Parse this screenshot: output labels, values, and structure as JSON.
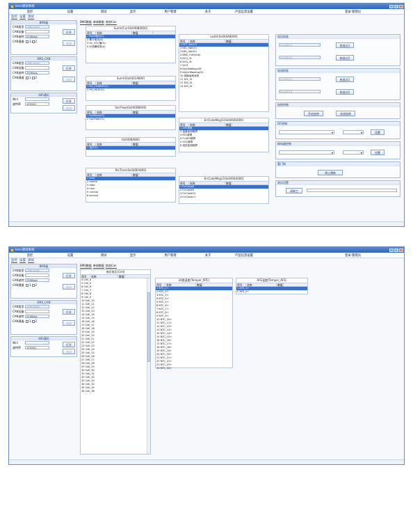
{
  "title": "bms测试系统",
  "titlebar_btns": [
    "_",
    "□",
    "×"
  ],
  "menu": [
    "监控",
    "设置",
    "测试",
    "显示",
    "用户管理",
    "关于",
    "产品信息设置"
  ],
  "status_user": "登录:管理员",
  "subtabs": [
    "监控",
    "设置",
    "测试"
  ],
  "left": {
    "g1_title": "BMS板",
    "can_type_lbl": "CAN类型",
    "can_type_val": "USBCAN2II",
    "can_dev_lbl": "CAN设备",
    "can_rate_lbl": "CAN波特",
    "can_rate_val": "250Kbps",
    "can_ch_lbl": "CAN通道",
    "ch1": "1",
    "ch2": "2",
    "open_btn": "打开",
    "close_btn": "关闭",
    "g2_title": "EMS_CAN",
    "g3_title": "485通讯",
    "port_lbl": "串口",
    "baud_lbl": "波特率",
    "baud_val": "115200"
  },
  "tabs1": [
    "BMS数据",
    "单体数据",
    "其他Can"
  ],
  "tabs2": [
    "BMS数据",
    "单体数据",
    "其他Can"
  ],
  "th": {
    "idx": "序号",
    "name": "名称",
    "val": "数值"
  },
  "p_sum": {
    "title": "SumV/Cur(0x04080000)",
    "rows": [
      "1 Pack电压(V)",
      "2 累计电流(A)",
      "3 Hv_SOC值(%)",
      "4 分流器电流(A)"
    ]
  },
  "p_sumv": {
    "title": "SumV(0x0401A800)",
    "rows": [
      "1 HV_CHARGE(V)",
      "2 HV_HEAT(V)"
    ]
  },
  "p_soc": {
    "title": "SocFlow(0x040D8000)",
    "rows": [
      "1 SocRatio(%)",
      "2 SocFloat(%)"
    ]
  },
  "p_0e": {
    "title": "0x040BA800",
    "rows": [
      "1 温升(V)"
    ]
  },
  "p_rtc": {
    "title": "RtcTime(0x040EA800)",
    "rows": [
      "1 year",
      "2 month",
      "3 date",
      "4 hour",
      "5 minute",
      "6 second"
    ]
  },
  "p_low": {
    "title": "LowV(0x040A8000)",
    "rows": [
      "1 KEY_Volt(V)",
      "2 KEL_Volt(V)",
      "3 KEL_Volt(V)",
      "4 BMS_CUR(mA)",
      "5 DO1_St",
      "6 DO2_St",
      "7 DO3",
      "8 Key(Wakeup)St",
      "9 Key2(Wakeup)St",
      "10 风扇运转状态",
      "11 DI1_St",
      "12 DI2_St",
      "13 DI3_St"
    ]
  },
  "p_err1": {
    "title": "ErrCodeMsg(1(0x04040000)",
    "rows": [
      "1 APE故障",
      "2 温度检测故障",
      "3 RTC故障",
      "4 FLASH故障",
      "5 SOC故障",
      "6 电压检测故障"
    ]
  },
  "p_err2": {
    "title": "ErrCodeMsg(2(0x04044000)",
    "rows": [
      "1 ErrCode8",
      "2 ErrCode9",
      "3 ErrCode10",
      "4 ErrCode11"
    ]
  },
  "right": {
    "g_volt": "电压校准",
    "v_ph1": "0.0-655.3",
    "v_ph2": "0.0-655.3",
    "btn_v1": "校准点1",
    "btn_v2": "校准点2",
    "g_cur": "电流校准",
    "c_ph1": "0.0-655.3",
    "c_ph2": "0.0-655.3",
    "btn_c1": "校准点1",
    "btn_c2": "校准点2",
    "g_heat": "加热控制",
    "btn_on": "开启加热",
    "btn_off": "关闭加热",
    "g_do": "DO控制",
    "set1": "设置",
    "g_relay": "继电器控制",
    "set2": "设置",
    "g_door": "看门狗",
    "btn_door": "停止喂狗",
    "g_test": "测试设置",
    "btn_write": "读取工"
  },
  "cells": {
    "title": "电芯电压(Cell)",
    "rows": [
      "4 Cell_4",
      "5 Cell_5",
      "6 Cell_6",
      "7 Cell_7",
      "8 Cell_8",
      "9 Cell_9",
      "10 Cell_10",
      "11 Cell_11",
      "12 Cell_12",
      "13 Cell_13",
      "14 Cell_14",
      "15 Cell_15",
      "16 Cell_16",
      "17 Cell_17",
      "18 Cell_18",
      "19 Cell_19",
      "20 Cell_20",
      "21 Cell_21",
      "22 Cell_22",
      "23 Cell_23",
      "24 Cell_24",
      "25 Cell_25",
      "26 Cell_26",
      "27 Cell_27",
      "28 Cell_28",
      "29 Cell_29",
      "30 Cell_30",
      "31 Cell_31",
      "32 Cell_32",
      "33 Cell_33",
      "34 Cell_34",
      "35 Cell_35",
      "36 Cell_36"
    ]
  },
  "ntc": {
    "title": "24路温度(Temper_NTC)",
    "rows": [
      "1 NTC_1+",
      "2 NTC_2+",
      "3 NTC_3+",
      "4 NTC_4+",
      "5 NTC_5+",
      "6 NTC_6+",
      "7 NTC_7+",
      "8 NTC_8+",
      "9 NTC_9+",
      "10 NTC_10+",
      "11 NTC_11+",
      "12 NTC_12+",
      "13 NTC_13+",
      "14 NTC_14+",
      "15 NTC_15+",
      "16 NTC_16+",
      "17 NTC_17+",
      "18 NTC_18+",
      "19 NTC_19+",
      "20 NTC_20+",
      "21 NTC_21+",
      "22 NTC_22+",
      "23 NTC_23+",
      "24 NTC_24+"
    ]
  },
  "afe": {
    "title": "AFE温度(Temper_AFE)",
    "rows": [
      "1 AFE_1+",
      "2 AFE_2+"
    ]
  }
}
